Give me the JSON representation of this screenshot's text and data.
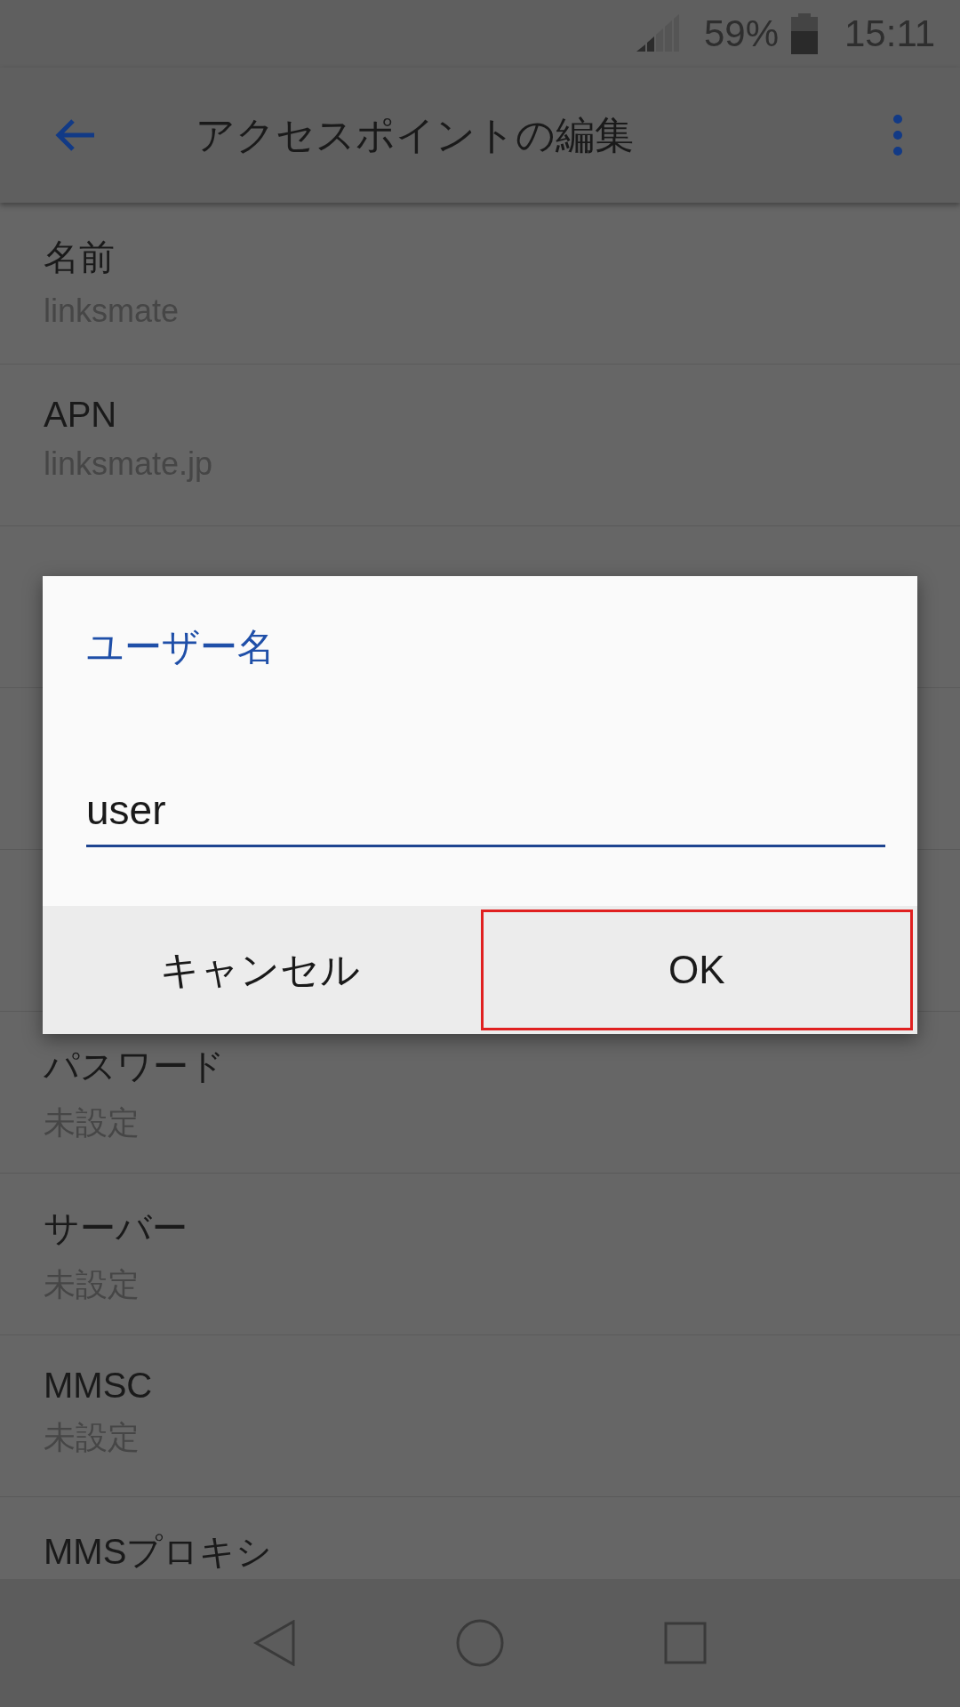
{
  "status_bar": {
    "battery": "59%",
    "time": "15:11"
  },
  "app_bar": {
    "title": "アクセスポイントの編集"
  },
  "settings": [
    {
      "title": "名前",
      "value": "linksmate"
    },
    {
      "title": "APN",
      "value": "linksmate.jp"
    },
    {
      "title": "パスワード",
      "value": "未設定"
    },
    {
      "title": "サーバー",
      "value": "未設定"
    },
    {
      "title": "MMSC",
      "value": "未設定"
    },
    {
      "title": "MMSプロキシ"
    }
  ],
  "dialog": {
    "title": "ユーザー名",
    "value": "user",
    "buttons": [
      {
        "label": "キャンセル",
        "highlighted": false
      },
      {
        "label": "OK",
        "highlighted": true
      }
    ]
  }
}
